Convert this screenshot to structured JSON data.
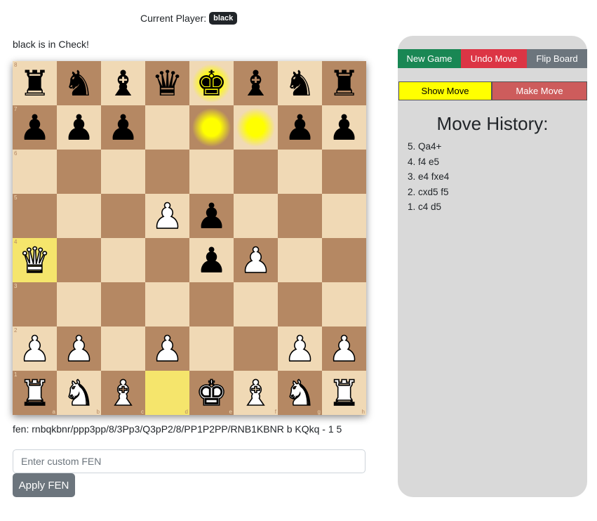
{
  "status": {
    "current_player_label": "Current Player:",
    "current_player": "black",
    "check_message": "black is in Check!"
  },
  "board": {
    "ranks": [
      "8",
      "7",
      "6",
      "5",
      "4",
      "3",
      "2",
      "1"
    ],
    "files": [
      "a",
      "b",
      "c",
      "d",
      "e",
      "f",
      "g",
      "h"
    ],
    "position": [
      [
        "r",
        "n",
        "b",
        "q",
        "k",
        "b",
        "n",
        "r"
      ],
      [
        "p",
        "p",
        "p",
        "",
        "",
        "",
        "p",
        "p"
      ],
      [
        "",
        "",
        "",
        "",
        "",
        "",
        "",
        ""
      ],
      [
        "",
        "",
        "",
        "P",
        "p",
        "",
        "",
        ""
      ],
      [
        "Q",
        "",
        "",
        "",
        "p",
        "P",
        "",
        ""
      ],
      [
        "",
        "",
        "",
        "",
        "",
        "",
        "",
        ""
      ],
      [
        "P",
        "P",
        "",
        "P",
        "",
        "",
        "P",
        "P"
      ],
      [
        "R",
        "N",
        "B",
        "",
        "K",
        "B",
        "N",
        "R"
      ]
    ],
    "last_move_squares": [
      "d1",
      "a4"
    ],
    "check_highlight_squares": [
      "e8",
      "e7",
      "f7"
    ],
    "colors": {
      "light": "#f0d9b5",
      "dark": "#b58863",
      "last_move": "#f5e56c",
      "check_glow": "#ffff00"
    }
  },
  "fen": {
    "text": "fen: rnbqkbnr/ppp3pp/8/3Pp3/Q3pP2/8/PP1P2PP/RNB1KBNR b KQkq - 1 5",
    "input_value": "",
    "input_placeholder": "Enter custom FEN",
    "apply_label": "Apply FEN"
  },
  "controls": {
    "new_game": "New Game",
    "undo_move": "Undo Move",
    "flip_board": "Flip Board",
    "show_move": "Show Move",
    "make_move": "Make Move"
  },
  "history": {
    "title": "Move History:",
    "moves": [
      "5. Qa4+",
      "4. f4 e5",
      "3. e4 fxe4",
      "2. cxd5 f5",
      "1. c4 d5"
    ]
  }
}
